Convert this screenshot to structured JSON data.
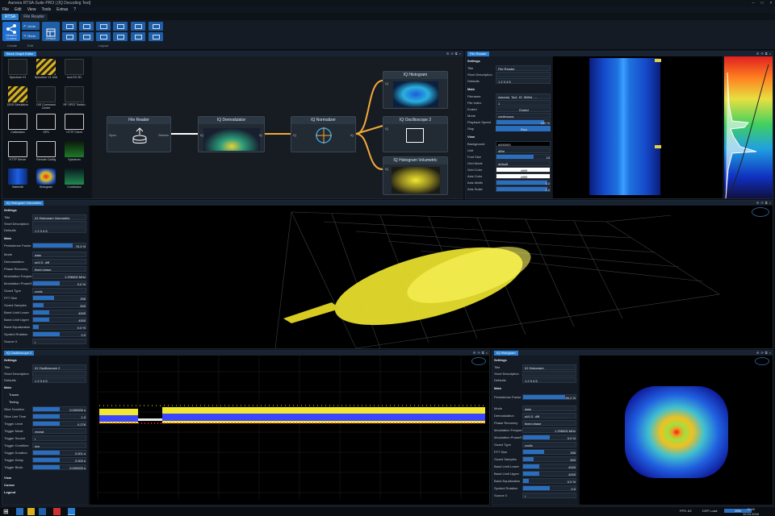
{
  "window": {
    "title": "Aaronia RTSA-Suite PRO | [IQ Decoding Test]"
  },
  "menu": [
    "File",
    "Edit",
    "View",
    "Tools",
    "Extras",
    "?"
  ],
  "tabs": [
    {
      "label": "RTSA"
    },
    {
      "label": "File Reader"
    }
  ],
  "ribbon": {
    "btn_mission": "Mission Control",
    "btn_undo": "Undo",
    "btn_redo": "Redo",
    "btn_default": "Default",
    "group_create": "Create",
    "group_edit": "Edit",
    "group_layout": "Layout"
  },
  "block_graph": {
    "title": "Block Graph Editor",
    "palette": [
      "Spectrum V1",
      "Spectrum V1 40A",
      "IsoLOG 3D",
      "DEIS Simulation",
      "DIS Command Center",
      "RF SPDT Switch",
      "Calibration",
      "GPS",
      "HTTP Client",
      "HTTP Server",
      "Remote Config",
      "Spectrum",
      "Waterfall",
      "Histogram",
      "Combobox"
    ],
    "nodes": {
      "file_reader": "File Reader",
      "iq_demodulator": "IQ Demodulator",
      "iq_normalizer": "IQ Normalizer",
      "iq_histogram": "IQ Histogram",
      "iq_oscilloscope": "IQ Oscilloscope 2",
      "iq_histogram_vol": "IQ Histogram Volumetric"
    },
    "ports": {
      "sync": "Sync",
      "stream": "Stream",
      "iq": "IQ"
    }
  },
  "file_reader_panel": {
    "title": "File Reader",
    "settings": "Settings",
    "rows": [
      {
        "label": "Title",
        "value": "File Reader"
      },
      {
        "label": "Short Description",
        "value": ""
      },
      {
        "label": "Defaults",
        "value": "1  2  3  4  5"
      }
    ],
    "main": "Main",
    "main_rows": [
      {
        "label": "Filename",
        "value": "Aaronia_Tool_IQ_5MHz_..."
      },
      {
        "label": "File Index",
        "value": "1"
      },
      {
        "label": "Ended",
        "value": "Ended"
      },
      {
        "label": "Mode",
        "value": "continuous"
      },
      {
        "label": "Playback Speed",
        "value": "100 %"
      },
      {
        "label": "Stop",
        "value": "Stop"
      }
    ],
    "view": "View",
    "view_rows": [
      {
        "label": "Background",
        "value": "#000000"
      },
      {
        "label": "Unit",
        "value": "dBm"
      },
      {
        "label": "Font Size",
        "value": "10"
      },
      {
        "label": "Grid Mode",
        "value": "default"
      },
      {
        "label": "Grid Color",
        "value": "#ffffff"
      },
      {
        "label": "Axis Color",
        "value": "#ffffff"
      },
      {
        "label": "Axis Width",
        "value": "1.0"
      },
      {
        "label": "Axis Scale",
        "value": "1.0"
      }
    ]
  },
  "volumetric": {
    "title": "IQ Histogram Volumetric",
    "settings": "Settings",
    "top_rows": [
      {
        "label": "Title",
        "value": "IQ Histogram Volumetric"
      },
      {
        "label": "Short Description",
        "value": ""
      },
      {
        "label": "Defaults",
        "value": "1  2  3  4  5"
      }
    ],
    "main": "Main",
    "rows": [
      {
        "label": "Persistence Factor",
        "value": "76.3 %"
      },
      {
        "label": "Mode",
        "value": "data"
      },
      {
        "label": "Demodulation",
        "value": "pi/4 D_diff"
      },
      {
        "label": "Phase Recovery",
        "value": "fixed phase"
      },
      {
        "label": "Modulation Frequency",
        "value": "1,296000 MHz"
      },
      {
        "label": "Modulation PhaseShift",
        "value": "0.0 %"
      },
      {
        "label": "Guard Type",
        "value": "cyclic"
      },
      {
        "label": "FFT Size",
        "value": "256"
      },
      {
        "label": "Guard Samples",
        "value": "500"
      },
      {
        "label": "Band Limit Lower",
        "value": "4000"
      },
      {
        "label": "Band Limit Upper",
        "value": "4000"
      },
      {
        "label": "Band Equalization",
        "value": "0.0 %"
      },
      {
        "label": "Symbol Rotation",
        "value": "0.0"
      },
      {
        "label": "Source X",
        "value": "I"
      }
    ]
  },
  "oscilloscope": {
    "title": "IQ Oscilloscope 2",
    "settings": "Settings",
    "top_rows": [
      {
        "label": "Title",
        "value": "IQ Oscilloscope 2"
      },
      {
        "label": "Short Description",
        "value": ""
      },
      {
        "label": "Defaults",
        "value": "1  2  3  4  5"
      }
    ],
    "main": "Main",
    "traces": "Traces",
    "timing": "Timing",
    "rows": [
      {
        "label": "Slice Duration",
        "value": "0,000000 s"
      },
      {
        "label": "Slice Line Time",
        "value": "1.0"
      },
      {
        "label": "Trigger Level",
        "value": "0.278"
      },
      {
        "label": "Trigger Mode",
        "value": "repeat"
      },
      {
        "label": "Trigger Source",
        "value": "I"
      },
      {
        "label": "Trigger Condition",
        "value": "low"
      },
      {
        "label": "Trigger Duration",
        "value": "0,001 s"
      },
      {
        "label": "Trigger Delay",
        "value": "0,000 s"
      },
      {
        "label": "Trigger Block",
        "value": "0,000000 s"
      }
    ],
    "view": "View",
    "cursor": "Cursor",
    "legend": "Legend"
  },
  "histogram": {
    "title": "IQ Histogram",
    "settings": "Settings",
    "top_rows": [
      {
        "label": "Title",
        "value": "IQ Histogram"
      },
      {
        "label": "Short Description",
        "value": ""
      },
      {
        "label": "Defaults",
        "value": "1  2  3  4  5"
      }
    ],
    "main": "Main",
    "rows": [
      {
        "label": "Persistence Factor",
        "value": "80.2 %"
      },
      {
        "label": "Mode",
        "value": "data"
      },
      {
        "label": "Demodulation",
        "value": "pi/4 D_diff"
      },
      {
        "label": "Phase Recovery",
        "value": "fixed phase"
      },
      {
        "label": "Modulation Frequency",
        "value": "1,296000 MHz"
      },
      {
        "label": "Modulation PhaseShift",
        "value": "0.0 %"
      },
      {
        "label": "Guard Type",
        "value": "cyclic"
      },
      {
        "label": "FFT Size",
        "value": "256"
      },
      {
        "label": "Guard Samples",
        "value": "500"
      },
      {
        "label": "Band Limit Lower",
        "value": "4000"
      },
      {
        "label": "Band Limit Upper",
        "value": "4000"
      },
      {
        "label": "Band Equalization",
        "value": "0.0 %"
      },
      {
        "label": "Symbol Rotation",
        "value": "0.0"
      },
      {
        "label": "Source X",
        "value": "I"
      }
    ]
  },
  "status": {
    "fps": "FPS: 63",
    "dsp_load": "DSP Load:",
    "load_val": "19%",
    "time": "16:40",
    "date": "10.04.2018"
  },
  "colors": {
    "accent": "#2a7fd0",
    "trace_yellow": "#f2e830",
    "trace_blue": "#3a46ff",
    "trace_red": "#e0202a",
    "link": "#f2a93a"
  }
}
